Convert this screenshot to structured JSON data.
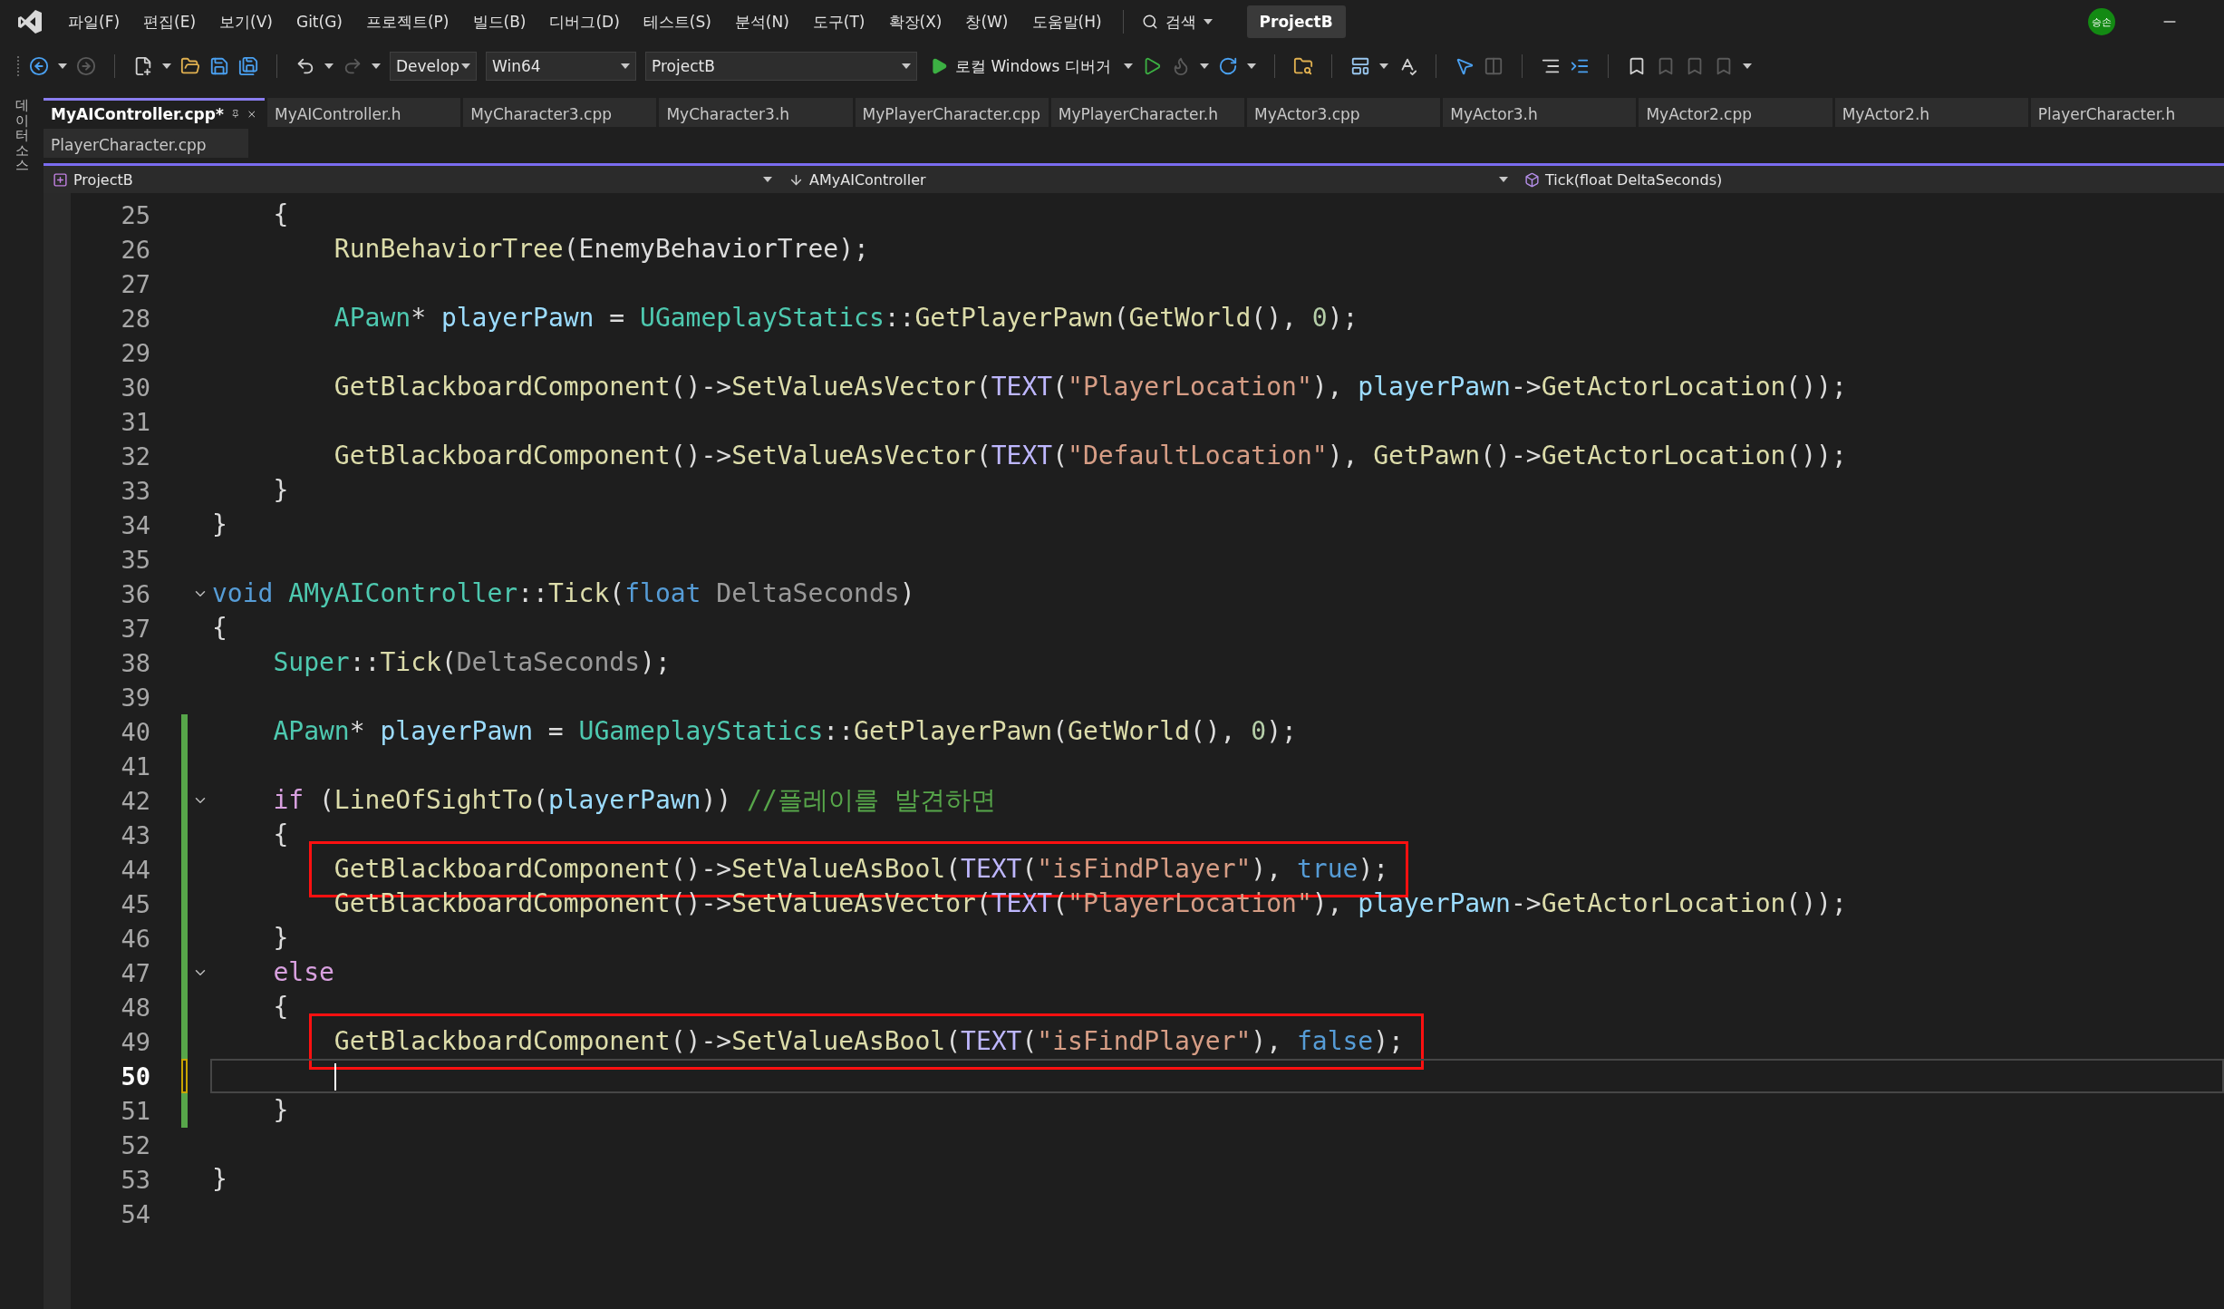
{
  "title_bar": {
    "menus": [
      "파일(F)",
      "편집(E)",
      "보기(V)",
      "Git(G)",
      "프로젝트(P)",
      "빌드(B)",
      "디버그(D)",
      "테스트(S)",
      "분석(N)",
      "도구(T)",
      "확장(X)",
      "창(W)",
      "도움말(H)"
    ],
    "search": "검색",
    "solution": "ProjectB",
    "account_initials": "승손"
  },
  "toolbar": {
    "configuration": "Develop",
    "platform": "Win64",
    "startup_project": "ProjectB",
    "debugger": "로컬 Windows 디버거"
  },
  "side_panel": {
    "label": "데이터 소스"
  },
  "tab_rows": [
    {
      "tabs": [
        {
          "label": "MyAIController.cpp*",
          "selected": true
        },
        {
          "label": "MyAIController.h",
          "selected": false
        },
        {
          "label": "MyCharacter3.cpp",
          "selected": false
        },
        {
          "label": "MyCharacter3.h",
          "selected": false
        },
        {
          "label": "MyPlayerCharacter.cpp",
          "selected": false
        },
        {
          "label": "MyPlayerCharacter.h",
          "selected": false
        },
        {
          "label": "MyActor3.cpp",
          "selected": false
        },
        {
          "label": "MyActor3.h",
          "selected": false
        },
        {
          "label": "MyActor2.cpp",
          "selected": false
        },
        {
          "label": "MyActor2.h",
          "selected": false
        },
        {
          "label": "PlayerCharacter.h",
          "selected": false
        }
      ]
    },
    {
      "tabs": [
        {
          "label": "PlayerCharacter.cpp",
          "selected": false
        }
      ]
    }
  ],
  "navigation_bar": {
    "project": "ProjectB",
    "class": "AMyAIController",
    "member": "Tick(float DeltaSeconds)"
  },
  "editor": {
    "lines": [
      {
        "number": "25",
        "current": false,
        "fold": false,
        "boxed": false,
        "modified": false,
        "tokens": [
          {
            "kind": "plain",
            "text": "    {"
          }
        ]
      },
      {
        "number": "26",
        "current": false,
        "fold": false,
        "boxed": false,
        "modified": false,
        "tokens": [
          {
            "kind": "func",
            "text": "        RunBehaviorTree"
          },
          {
            "kind": "plain",
            "text": "(EnemyBehaviorTree);"
          }
        ]
      },
      {
        "number": "27",
        "current": false,
        "fold": false,
        "boxed": false,
        "modified": false
      },
      {
        "number": "28",
        "current": false,
        "fold": false,
        "boxed": false,
        "modified": false,
        "tokens": [
          {
            "kind": "type",
            "text": "        APawn"
          },
          {
            "kind": "plain",
            "text": "* "
          },
          {
            "kind": "var",
            "text": "playerPawn"
          },
          {
            "kind": "plain",
            "text": " = "
          },
          {
            "kind": "type",
            "text": "UGameplayStatics"
          },
          {
            "kind": "plain",
            "text": "::"
          },
          {
            "kind": "func",
            "text": "GetPlayerPawn"
          },
          {
            "kind": "plain",
            "text": "("
          },
          {
            "kind": "func",
            "text": "GetWorld"
          },
          {
            "kind": "plain",
            "text": "(), "
          },
          {
            "kind": "number",
            "text": "0"
          },
          {
            "kind": "plain",
            "text": ");"
          }
        ]
      },
      {
        "number": "29",
        "current": false,
        "fold": false,
        "boxed": false,
        "modified": false
      },
      {
        "number": "30",
        "current": false,
        "fold": false,
        "boxed": false,
        "modified": false,
        "tokens": [
          {
            "kind": "func",
            "text": "        GetBlackboardComponent"
          },
          {
            "kind": "plain",
            "text": "()->"
          },
          {
            "kind": "func",
            "text": "SetValueAsVector"
          },
          {
            "kind": "plain",
            "text": "("
          },
          {
            "kind": "macro",
            "text": "TEXT"
          },
          {
            "kind": "plain",
            "text": "("
          },
          {
            "kind": "string",
            "text": "\"PlayerLocation\""
          },
          {
            "kind": "plain",
            "text": "), "
          },
          {
            "kind": "var",
            "text": "playerPawn"
          },
          {
            "kind": "plain",
            "text": "->"
          },
          {
            "kind": "func",
            "text": "GetActorLocation"
          },
          {
            "kind": "plain",
            "text": "());"
          }
        ]
      },
      {
        "number": "31",
        "current": false,
        "fold": false,
        "boxed": false,
        "modified": false
      },
      {
        "number": "32",
        "current": false,
        "fold": false,
        "boxed": false,
        "modified": false,
        "tokens": [
          {
            "kind": "func",
            "text": "        GetBlackboardComponent"
          },
          {
            "kind": "plain",
            "text": "()->"
          },
          {
            "kind": "func",
            "text": "SetValueAsVector"
          },
          {
            "kind": "plain",
            "text": "("
          },
          {
            "kind": "macro",
            "text": "TEXT"
          },
          {
            "kind": "plain",
            "text": "("
          },
          {
            "kind": "string",
            "text": "\"DefaultLocation\""
          },
          {
            "kind": "plain",
            "text": "), "
          },
          {
            "kind": "func",
            "text": "GetPawn"
          },
          {
            "kind": "plain",
            "text": "()->"
          },
          {
            "kind": "func",
            "text": "GetActorLocation"
          },
          {
            "kind": "plain",
            "text": "());"
          }
        ]
      },
      {
        "number": "33",
        "current": false,
        "fold": false,
        "boxed": false,
        "modified": false,
        "tokens": [
          {
            "kind": "plain",
            "text": "    }"
          }
        ]
      },
      {
        "number": "34",
        "current": false,
        "fold": false,
        "boxed": false,
        "modified": false,
        "tokens": [
          {
            "kind": "plain",
            "text": "}"
          }
        ]
      },
      {
        "number": "35",
        "current": false,
        "fold": false,
        "boxed": false,
        "modified": false
      },
      {
        "number": "36",
        "current": false,
        "fold": true,
        "boxed": false,
        "modified": false,
        "tokens": [
          {
            "kind": "keyword",
            "text": "void"
          },
          {
            "kind": "type",
            "text": " AMyAIController"
          },
          {
            "kind": "plain",
            "text": "::"
          },
          {
            "kind": "func",
            "text": "Tick"
          },
          {
            "kind": "plain",
            "text": "("
          },
          {
            "kind": "keyword",
            "text": "float"
          },
          {
            "kind": "param",
            "text": " DeltaSeconds"
          },
          {
            "kind": "plain",
            "text": ")"
          }
        ]
      },
      {
        "number": "37",
        "current": false,
        "fold": false,
        "boxed": false,
        "modified": false,
        "tokens": [
          {
            "kind": "plain",
            "text": "{"
          }
        ]
      },
      {
        "number": "38",
        "current": false,
        "fold": false,
        "boxed": false,
        "modified": false,
        "tokens": [
          {
            "kind": "type",
            "text": "    Super"
          },
          {
            "kind": "plain",
            "text": "::"
          },
          {
            "kind": "func",
            "text": "Tick"
          },
          {
            "kind": "plain",
            "text": "("
          },
          {
            "kind": "param",
            "text": "DeltaSeconds"
          },
          {
            "kind": "plain",
            "text": ");"
          }
        ]
      },
      {
        "number": "39",
        "current": false,
        "fold": false,
        "boxed": false,
        "modified": false
      },
      {
        "number": "40",
        "current": false,
        "fold": false,
        "boxed": false,
        "modified": true,
        "saved": true,
        "tokens": [
          {
            "kind": "type",
            "text": "    APawn"
          },
          {
            "kind": "plain",
            "text": "* "
          },
          {
            "kind": "var",
            "text": "playerPawn"
          },
          {
            "kind": "plain",
            "text": " = "
          },
          {
            "kind": "type",
            "text": "UGameplayStatics"
          },
          {
            "kind": "plain",
            "text": "::"
          },
          {
            "kind": "func",
            "text": "GetPlayerPawn"
          },
          {
            "kind": "plain",
            "text": "("
          },
          {
            "kind": "func",
            "text": "GetWorld"
          },
          {
            "kind": "plain",
            "text": "(), "
          },
          {
            "kind": "number",
            "text": "0"
          },
          {
            "kind": "plain",
            "text": ");"
          }
        ]
      },
      {
        "number": "41",
        "current": false,
        "fold": false,
        "boxed": false,
        "modified": true,
        "saved": true
      },
      {
        "number": "42",
        "current": false,
        "fold": true,
        "boxed": false,
        "modified": true,
        "saved": true,
        "tokens": [
          {
            "kind": "control",
            "text": "    if"
          },
          {
            "kind": "plain",
            "text": " ("
          },
          {
            "kind": "func",
            "text": "LineOfSightTo"
          },
          {
            "kind": "plain",
            "text": "("
          },
          {
            "kind": "var",
            "text": "playerPawn"
          },
          {
            "kind": "plain",
            "text": ")) "
          },
          {
            "kind": "comment",
            "text": "//플레이를 발견하면"
          }
        ]
      },
      {
        "number": "43",
        "current": false,
        "fold": false,
        "boxed": false,
        "modified": true,
        "saved": true,
        "tokens": [
          {
            "kind": "plain",
            "text": "    {"
          }
        ]
      },
      {
        "number": "44",
        "current": false,
        "fold": false,
        "boxed": true,
        "modified": true,
        "saved": true,
        "tokens": [
          {
            "kind": "func",
            "text": "        GetBlackboardComponent"
          },
          {
            "kind": "plain",
            "text": "()->"
          },
          {
            "kind": "func",
            "text": "SetValueAsBool"
          },
          {
            "kind": "plain",
            "text": "("
          },
          {
            "kind": "macro",
            "text": "TEXT"
          },
          {
            "kind": "plain",
            "text": "("
          },
          {
            "kind": "string",
            "text": "\"isFindPlayer\""
          },
          {
            "kind": "plain",
            "text": "), "
          },
          {
            "kind": "keyword",
            "text": "true"
          },
          {
            "kind": "plain",
            "text": ");"
          }
        ]
      },
      {
        "number": "45",
        "current": false,
        "fold": false,
        "boxed": false,
        "modified": true,
        "saved": true,
        "tokens": [
          {
            "kind": "func",
            "text": "        GetBlackboardComponent"
          },
          {
            "kind": "plain",
            "text": "()->"
          },
          {
            "kind": "func",
            "text": "SetValueAsVector"
          },
          {
            "kind": "plain",
            "text": "("
          },
          {
            "kind": "macro",
            "text": "TEXT"
          },
          {
            "kind": "plain",
            "text": "("
          },
          {
            "kind": "string",
            "text": "\"PlayerLocation\""
          },
          {
            "kind": "plain",
            "text": "), "
          },
          {
            "kind": "var",
            "text": "playerPawn"
          },
          {
            "kind": "plain",
            "text": "->"
          },
          {
            "kind": "func",
            "text": "GetActorLocation"
          },
          {
            "kind": "plain",
            "text": "());"
          }
        ]
      },
      {
        "number": "46",
        "current": false,
        "fold": false,
        "boxed": false,
        "modified": true,
        "saved": true,
        "tokens": [
          {
            "kind": "plain",
            "text": "    }"
          }
        ]
      },
      {
        "number": "47",
        "current": false,
        "fold": true,
        "boxed": false,
        "modified": true,
        "saved": true,
        "tokens": [
          {
            "kind": "control",
            "text": "    else"
          }
        ]
      },
      {
        "number": "48",
        "current": false,
        "fold": false,
        "boxed": false,
        "modified": true,
        "saved": true,
        "tokens": [
          {
            "kind": "plain",
            "text": "    {"
          }
        ]
      },
      {
        "number": "49",
        "current": false,
        "fold": false,
        "boxed": true,
        "modified": true,
        "saved": true,
        "tokens": [
          {
            "kind": "func",
            "text": "        GetBlackboardComponent"
          },
          {
            "kind": "plain",
            "text": "()->"
          },
          {
            "kind": "func",
            "text": "SetValueAsBool"
          },
          {
            "kind": "plain",
            "text": "("
          },
          {
            "kind": "macro",
            "text": "TEXT"
          },
          {
            "kind": "plain",
            "text": "("
          },
          {
            "kind": "string",
            "text": "\"isFindPlayer\""
          },
          {
            "kind": "plain",
            "text": "), "
          },
          {
            "kind": "keyword",
            "text": "false"
          },
          {
            "kind": "plain",
            "text": ");"
          }
        ]
      },
      {
        "number": "50",
        "current": true,
        "fold": false,
        "boxed": false,
        "modified": true,
        "saved": false
      },
      {
        "number": "51",
        "current": false,
        "fold": false,
        "boxed": false,
        "modified": true,
        "saved": true,
        "tokens": [
          {
            "kind": "plain",
            "text": "    }"
          }
        ]
      },
      {
        "number": "52",
        "current": false,
        "fold": false,
        "boxed": false,
        "modified": false
      },
      {
        "number": "53",
        "current": false,
        "fold": false,
        "boxed": false,
        "modified": false,
        "tokens": [
          {
            "kind": "plain",
            "text": "}"
          }
        ]
      },
      {
        "number": "54",
        "current": false,
        "fold": false,
        "boxed": false,
        "modified": false
      }
    ]
  }
}
